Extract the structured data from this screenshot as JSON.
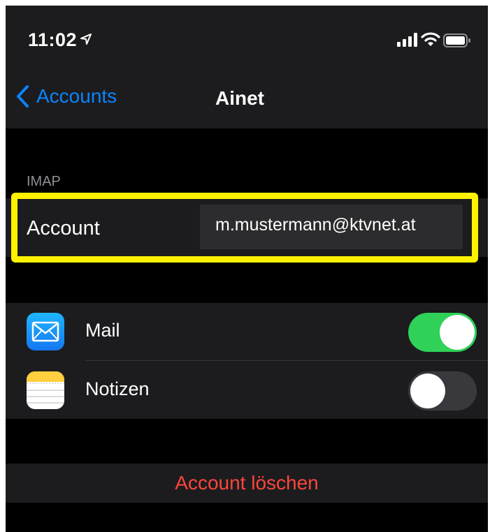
{
  "status_bar": {
    "time": "11:02",
    "icons": [
      "location-arrow-icon",
      "signal-icon",
      "wifi-icon",
      "battery-icon"
    ]
  },
  "nav": {
    "back_label": "Accounts",
    "title": "Ainet"
  },
  "section": {
    "header": "IMAP"
  },
  "account_row": {
    "label": "Account",
    "value": "m.mustermann@ktvnet.at",
    "highlight_color": "#fff200"
  },
  "apps": [
    {
      "label": "Mail",
      "icon": "mail-icon",
      "enabled": true
    },
    {
      "label": "Notizen",
      "icon": "notes-icon",
      "enabled": false
    }
  ],
  "delete_button": {
    "label": "Account löschen",
    "color": "#ff453a"
  },
  "colors": {
    "accent": "#0a84ff",
    "toggle_on": "#30d158",
    "background": "#000000",
    "cell": "#1c1c1e"
  }
}
